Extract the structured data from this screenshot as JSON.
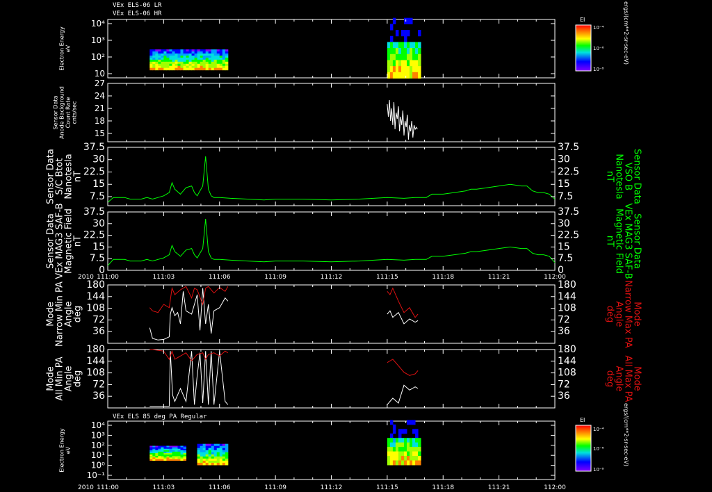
{
  "header": {
    "line1": "VEx ELS-06 LR",
    "line2": "VEx ELS-06 HR",
    "bottom_title": "VEx ELS 85 deg PA Regular",
    "year": "2010"
  },
  "colors": {
    "background": "#000000",
    "frame": "#ffffff",
    "green": "#00ff00",
    "red": "#dd1111",
    "white": "#ffffff"
  },
  "colorbar": {
    "label": "EI",
    "units": "ergs/(cm**2-sr-sec-eV)",
    "ticks": [
      "10⁻⁴",
      "10⁻⁶",
      "10⁻⁸"
    ]
  },
  "x_axis": {
    "ticks": [
      "111:00",
      "111:03",
      "111:06",
      "111:09",
      "111:12",
      "111:15",
      "111:18",
      "111:21",
      "112:00"
    ]
  },
  "chart_data": [
    {
      "type": "heatmap",
      "panel": "els_lr_hr_spectrogram",
      "ylabel": [
        "Electron Energy",
        "eV"
      ],
      "y_ticks": [
        "10⁴",
        "10³",
        "10²",
        "10"
      ],
      "y_scale": "log",
      "x_unit": "minutes after 111:00",
      "segments": [
        {
          "x_start": 7.5,
          "x_end": 21.5,
          "y_min": 10,
          "y_max": 200
        },
        {
          "x_start": 50,
          "x_end": 56,
          "y_min": 3,
          "y_max": 20000
        }
      ]
    },
    {
      "type": "line",
      "panel": "anode_background",
      "ylabel": [
        "Sensor Data",
        "Anode Background",
        "Count Rate",
        "cnts/sec"
      ],
      "ylim": [
        13,
        27
      ],
      "y_ticks": [
        27,
        24,
        21,
        18,
        15
      ],
      "series": [
        {
          "color": "white",
          "x": [
            50,
            50.2,
            50.4,
            50.6,
            50.8,
            51.0,
            51.2,
            51.4,
            51.6,
            51.8,
            52.0,
            52.2,
            52.4,
            52.6,
            52.8,
            53.0,
            53.2,
            53.4,
            53.6,
            53.8,
            54.0,
            54.2,
            54.4,
            54.6,
            54.8,
            55.0,
            55.2,
            55.4
          ],
          "y": [
            22,
            19,
            23,
            18,
            21,
            17,
            22.5,
            16,
            20,
            18.5,
            21.5,
            15.5,
            19,
            17,
            20.5,
            14.5,
            18,
            16.5,
            19.5,
            13.5,
            17,
            15.5,
            18,
            14,
            17,
            16,
            16.5,
            16
          ]
        }
      ]
    },
    {
      "type": "line",
      "panel": "sc_btot",
      "ylabel": [
        "Sensor Data",
        "S/C Btot",
        "Nanotesla",
        "nT"
      ],
      "ylabel_right": [
        "Sensor Data",
        "VSO B",
        "Nanotesla",
        "nT"
      ],
      "ylim": [
        2,
        37.5
      ],
      "y_ticks": [
        37.5,
        30.0,
        22.5,
        15.0,
        7.5
      ],
      "series": [
        {
          "color": "green",
          "x": [
            0,
            1,
            2,
            3,
            4,
            5,
            6,
            7,
            8,
            9,
            10,
            11,
            11.5,
            12,
            13,
            14,
            15,
            15.5,
            16,
            17,
            17.5,
            18,
            18.5,
            19,
            20,
            22,
            25,
            28,
            30,
            35,
            40,
            45,
            50,
            53,
            55,
            57,
            58,
            60,
            62,
            64,
            65,
            66,
            68,
            70,
            72,
            74,
            75,
            76,
            77,
            78,
            79,
            80
          ],
          "y": [
            4,
            7,
            7,
            7,
            6,
            6,
            6,
            7,
            6,
            7,
            8,
            10,
            16,
            12,
            9,
            13,
            14,
            10,
            8,
            14,
            32,
            12,
            8,
            7,
            7,
            6.5,
            6,
            5.5,
            6,
            6,
            5.5,
            6,
            7,
            6.5,
            7,
            7,
            9,
            9,
            10,
            11,
            12,
            12,
            13,
            14,
            15,
            14,
            14,
            11,
            10,
            10,
            9,
            6
          ]
        }
      ]
    },
    {
      "type": "line",
      "panel": "mag_saf_b",
      "ylabel": [
        "Sensor Data",
        "VEx MAG3 SAF-B",
        "Magnetic Field",
        "nT"
      ],
      "ylabel_right": [
        "Sensor Data",
        "VEx MAG3 SAF-B",
        "Magnetic Field",
        "nT"
      ],
      "ylim": [
        0,
        37.5
      ],
      "y_ticks": [
        37.5,
        30.0,
        22.5,
        15.0,
        7.5,
        0.0
      ],
      "series": [
        {
          "color": "green",
          "x": [
            0,
            1,
            2,
            3,
            4,
            5,
            6,
            7,
            8,
            9,
            10,
            11,
            11.5,
            12,
            13,
            14,
            15,
            15.5,
            16,
            17,
            17.5,
            18,
            18.5,
            19,
            20,
            22,
            25,
            28,
            30,
            35,
            40,
            45,
            50,
            53,
            55,
            57,
            58,
            60,
            62,
            64,
            65,
            66,
            68,
            70,
            72,
            74,
            75,
            76,
            77,
            78,
            79,
            80
          ],
          "y": [
            3,
            7,
            7,
            7,
            6,
            6,
            6,
            7,
            6,
            7,
            8,
            10,
            16,
            12,
            9,
            13,
            14,
            10,
            8,
            14,
            33,
            12,
            8,
            7,
            7,
            6.5,
            6,
            5.5,
            6,
            6,
            5.5,
            6,
            7,
            6.5,
            7,
            7,
            9,
            9,
            10,
            11,
            12,
            12,
            13,
            14,
            15,
            14,
            14,
            11,
            10,
            10,
            9,
            5
          ]
        }
      ]
    },
    {
      "type": "line",
      "panel": "narrow_pa",
      "ylabel": [
        "Mode",
        "Narrow Min PA",
        "Angle",
        "deg"
      ],
      "ylabel_right": [
        "Mode",
        "Narrow Max PA",
        "Angle",
        "deg"
      ],
      "ylim": [
        0,
        180
      ],
      "y_ticks": [
        180,
        144,
        108,
        72,
        36
      ],
      "series": [
        {
          "color": "white",
          "x": [
            7.5,
            8,
            9,
            10,
            11,
            11.2,
            11.5,
            12,
            12.5,
            13,
            13.5,
            14,
            15,
            16,
            16.5,
            17,
            17.5,
            18,
            18.5,
            19,
            20,
            21,
            21.5,
            50,
            50.5,
            51,
            52,
            53,
            54,
            55,
            55.5
          ],
          "y": [
            48,
            15,
            10,
            12,
            20,
            90,
            110,
            85,
            95,
            60,
            160,
            100,
            90,
            150,
            40,
            170,
            60,
            120,
            30,
            100,
            110,
            140,
            130,
            90,
            100,
            80,
            95,
            60,
            75,
            65,
            70
          ]
        },
        {
          "color": "red",
          "x": [
            7.5,
            8,
            9,
            10,
            11,
            11.5,
            12,
            13,
            14,
            15,
            15.5,
            16,
            17,
            17.5,
            18,
            19,
            20,
            21,
            21.5,
            50,
            50.5,
            51,
            52,
            53,
            54,
            55,
            55.5
          ],
          "y": [
            110,
            100,
            95,
            120,
            110,
            170,
            150,
            165,
            175,
            140,
            170,
            165,
            120,
            170,
            175,
            155,
            172,
            160,
            175,
            160,
            150,
            170,
            130,
            95,
            110,
            80,
            90
          ]
        }
      ]
    },
    {
      "type": "line",
      "panel": "all_pa",
      "ylabel": [
        "Mode",
        "All Min PA",
        "Angle",
        "deg"
      ],
      "ylabel_right": [
        "Mode",
        "All Max PA",
        "Angle",
        "deg"
      ],
      "ylim": [
        0,
        180
      ],
      "y_ticks": [
        180,
        144,
        108,
        72,
        36
      ],
      "series": [
        {
          "color": "white",
          "x": [
            7.5,
            8,
            10,
            11,
            11.2,
            11.6,
            12,
            13,
            14,
            15,
            15.5,
            16,
            16.5,
            17,
            17.5,
            18,
            18.5,
            19,
            20,
            21,
            21.5,
            50,
            51,
            52,
            53,
            54,
            55,
            55.5
          ],
          "y": [
            5,
            5,
            5,
            5,
            175,
            40,
            20,
            60,
            20,
            175,
            10,
            100,
            170,
            15,
            175,
            10,
            175,
            10,
            175,
            20,
            10,
            10,
            30,
            15,
            70,
            55,
            65,
            60
          ]
        },
        {
          "color": "red",
          "x": [
            7.5,
            8,
            10,
            11,
            11.5,
            12,
            13,
            14,
            15,
            16,
            17,
            17.5,
            18,
            19,
            20,
            21,
            21.5,
            50,
            51,
            52,
            53,
            54,
            55,
            55.5
          ],
          "y": [
            180,
            180,
            175,
            150,
            175,
            150,
            160,
            170,
            145,
            165,
            170,
            150,
            165,
            170,
            160,
            175,
            170,
            140,
            150,
            130,
            110,
            100,
            105,
            115
          ]
        }
      ]
    },
    {
      "type": "heatmap",
      "panel": "els_85deg_spectrogram",
      "ylabel": [
        "Electron Energy",
        "eV"
      ],
      "y_ticks": [
        "10⁴",
        "10³",
        "10²",
        "10¹",
        "10⁰",
        "10⁻¹"
      ],
      "y_scale": "log",
      "x_unit": "minutes after 111:00",
      "segments": [
        {
          "x_start": 7.5,
          "x_end": 14,
          "y_min": 5,
          "y_max": 100
        },
        {
          "x_start": 16,
          "x_end": 21.5,
          "y_min": 2,
          "y_max": 150
        },
        {
          "x_start": 50,
          "x_end": 56,
          "y_min": 2,
          "y_max": 20000
        }
      ]
    }
  ]
}
